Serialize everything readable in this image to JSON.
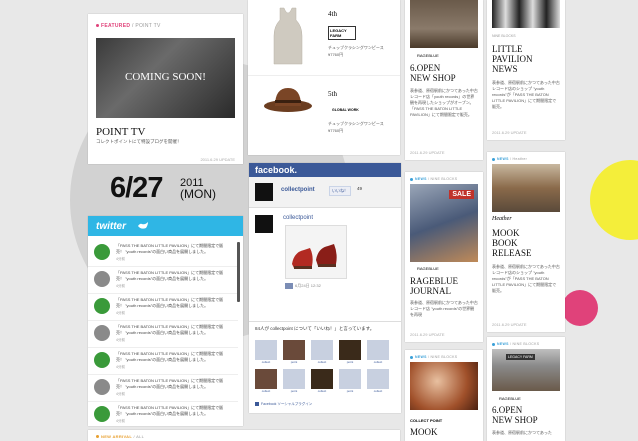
{
  "featured": {
    "tag": "FEATURED",
    "tag_sub": "/ POINT TV",
    "coming_soon": "COMING SOON!",
    "title": "POINT TV",
    "desc": "コレクトポイントにて特設ブログを開催！",
    "date": "2011.6.29 UPDATE"
  },
  "products": {
    "item1_label": "4th",
    "item1_brand": "LEGACY FARM",
    "item1_desc": "チュッブクラシングワンピース",
    "item1_price": "¥7760円",
    "item2_label": "5th",
    "item2_brand": "GLOBAL WORK",
    "item2_desc": "チュッブクラシングワンピース",
    "item2_price": "¥7760円"
  },
  "date_display": {
    "day": "6/27",
    "year": "2011",
    "weekday": "(MON)"
  },
  "twitter": {
    "logo": "twitter",
    "tweets": [
      {
        "text": "「PASS THE BATON LITTLE PAVILION」にて期間限定で販売！ \"youth records\"の面白い商品を展開しました。",
        "time": "4分前"
      },
      {
        "text": "「PASS THE BATON LITTLE PAVILION」にて期間限定で販売！ \"youth records\"の面白い商品を展開しました。",
        "time": "4分前"
      },
      {
        "text": "「PASS THE BATON LITTLE PAVILION」にて期間限定で販売！ \"youth records\"の面白い商品を展開しました。",
        "time": "4分前"
      },
      {
        "text": "「PASS THE BATON LITTLE PAVILION」にて期間限定で販売！ \"youth records\"の面白い商品を展開しました。",
        "time": "4分前"
      },
      {
        "text": "「PASS THE BATON LITTLE PAVILION」にて期間限定で販売！ \"youth records\"の面白い商品を展開しました。",
        "time": "4分前"
      },
      {
        "text": "「PASS THE BATON LITTLE PAVILION」にて期間限定で販売！ \"youth records\"の面白い商品を展開しました。",
        "time": "4分前"
      },
      {
        "text": "「PASS THE BATON LITTLE PAVILION」にて期間限定で販売！ \"youth records\"の面白い商品を展開しました。",
        "time": "4分前"
      }
    ]
  },
  "facebook": {
    "logo": "facebook.",
    "page_name": "collectpoint",
    "like": "いいね！",
    "like_count": "49",
    "post_name": "collectpoint",
    "post_time": "6月24日 12:32",
    "fans_line": "84人が collectpoint について「いいね！」と言っています。",
    "fan_names": [
      "collect",
      "point",
      "collect",
      "point",
      "collect",
      "collect",
      "point",
      "collect",
      "point",
      "collect"
    ],
    "plugin": "Facebook ソーシャルプラグイン"
  },
  "col3": {
    "shop_brand": "RAGEBLUE",
    "shop_title_1": "6.OPEN",
    "shop_title_2": "NEW SHOP",
    "shop_desc": "表参道、原宿駅前にかつてあった中古レコード店「youth records」の世界観を再現したショップがオープン。「PASS THE BATON LITTLE PAVILION」にて期間限定で販売。",
    "shop_date": "2011.6.29 UPDATE",
    "news_tag": "NEWS",
    "news_sub": "/ NINE BLOCKS",
    "journal_brand": "RAGEBLUE",
    "journal_title_1": "RAGEBLUE",
    "journal_title_2": "JOURNAL",
    "journal_desc": "表参道、原宿駅前にかつてあった中古レコード店 \"youth records\"の世界観を再現",
    "journal_date": "2011.6.29 UPDATE",
    "news2_tag": "NEWS",
    "news2_sub": "/ NINE BLOCKS",
    "bottom_brand": "COLLECT POINT",
    "bottom_title": "MOOK"
  },
  "col4": {
    "top_tag": "NINE BLOCKS",
    "pavilion_1": "LITTLE",
    "pavilion_2": "PAVILION",
    "pavilion_3": "NEWS",
    "pavilion_desc": "表参道、原宿駅前にかつてあった中古レコード店のショップ \"youth records\"が「PASS THE BATON LITTLE PAVILION」にて期間限定で販売。",
    "pavilion_date": "2011.6.29 UPDATE",
    "news_tag": "NEWS",
    "news_sub": "/ Heather",
    "mook_brand": "Heather",
    "mook_1": "MOOK",
    "mook_2": "BOOK",
    "mook_3": "RELEASE",
    "mook_desc": "表参道、原宿駅前にかつてあった中古レコード店のショップ \"youth records\"が「PASS THE BATON LITTLE PAVILION」にて期間限定で販売。",
    "mook_date": "2011.6.29 UPDATE",
    "news2_tag": "NEWS",
    "news2_sub": "/ NINE BLOCKS",
    "store_sign": "LEGACY FARM",
    "bottom_brand": "RAGEBLUE",
    "bottom_title_1": "6.OPEN",
    "bottom_title_2": "NEW SHOP",
    "bottom_desc": "表参道、原宿駅前にかつてあった"
  },
  "new_arrival": {
    "tag": "NEW ARRIVAL",
    "sub": "/ ALL"
  },
  "colors": {
    "twitter": "#2fb6e5",
    "facebook": "#3b5998",
    "news_dot": "#3aa0d8",
    "featured_dot": "#e0427a",
    "accent_yellow": "#f4ee3a",
    "accent_pink": "#e0427a"
  }
}
